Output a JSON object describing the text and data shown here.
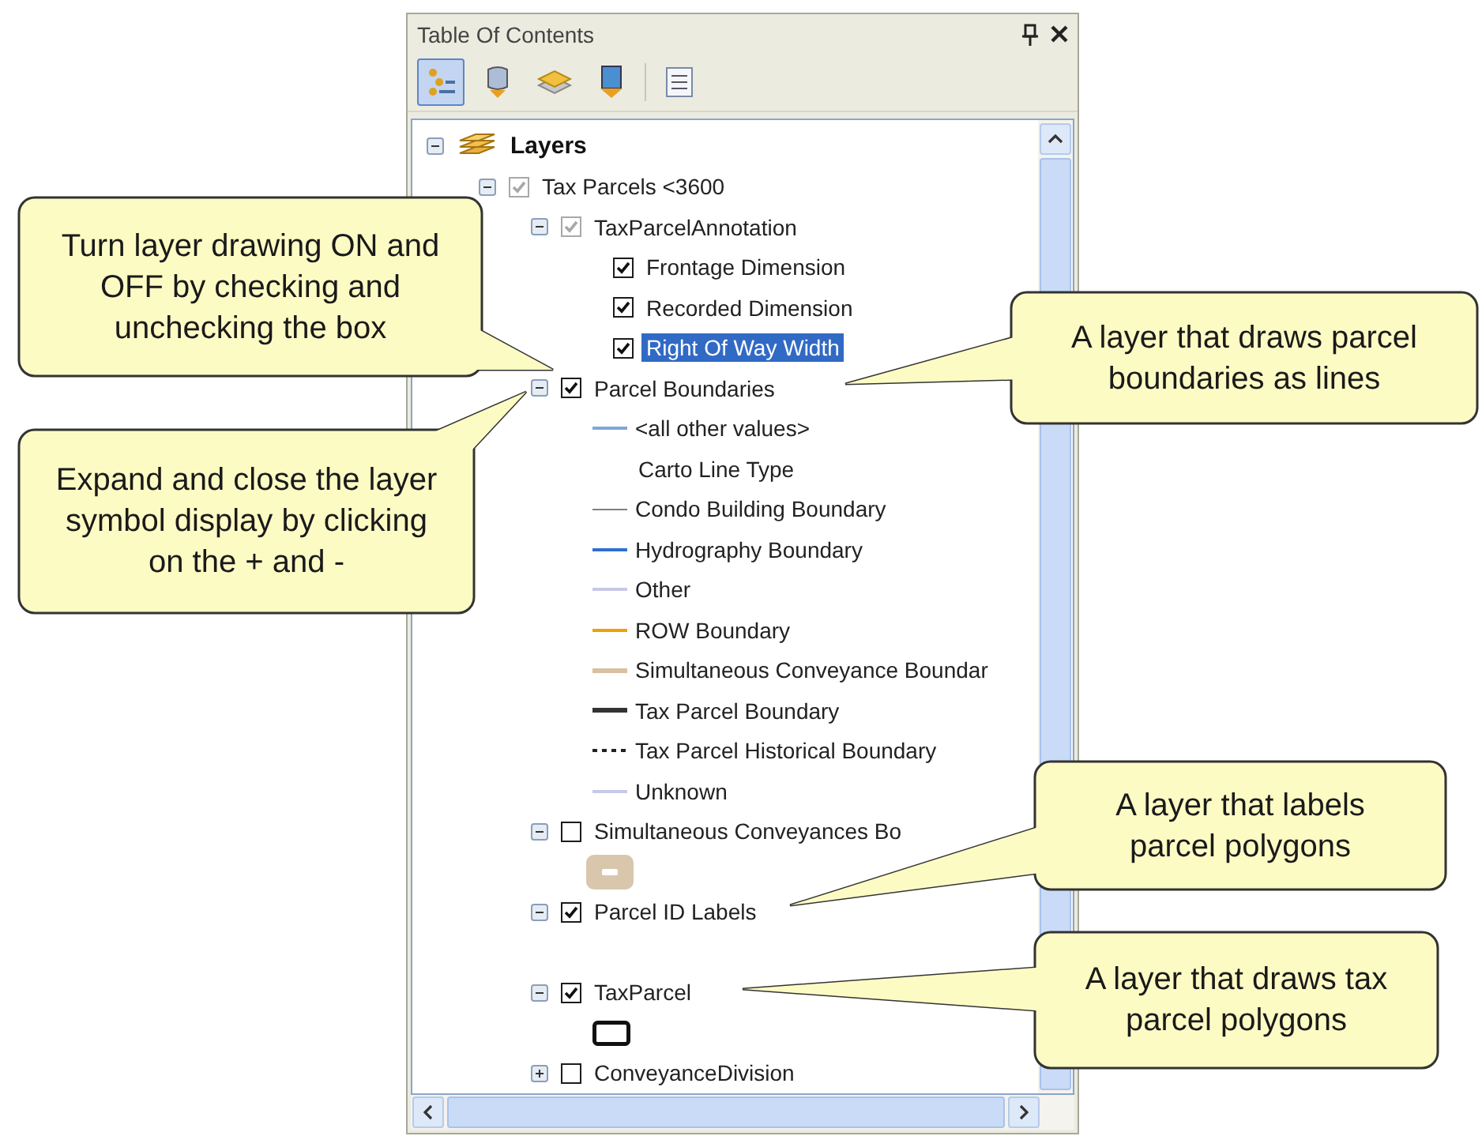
{
  "panel": {
    "title": "Table Of Contents"
  },
  "toolbar": [
    {
      "kind": "drawing-order",
      "selected": true
    },
    {
      "kind": "source",
      "selected": false
    },
    {
      "kind": "visibility",
      "selected": false
    },
    {
      "kind": "selection",
      "selected": false
    },
    {
      "kind": "options",
      "selected": false
    }
  ],
  "tree": {
    "label": "Layers",
    "kind": "frame",
    "expanded": true,
    "children": [
      {
        "label": "Tax Parcels <3600",
        "kind": "layer",
        "checked": true,
        "dimmed": true,
        "expanded": true,
        "selected": false,
        "children": [
          {
            "label": "TaxParcelAnnotation",
            "kind": "layer",
            "checked": true,
            "dimmed": true,
            "expanded": true,
            "selected": false,
            "children": [
              {
                "label": "Frontage Dimension",
                "kind": "class",
                "checked": true,
                "dimmed": false,
                "selected": false
              },
              {
                "label": "Recorded Dimension",
                "kind": "class",
                "checked": true,
                "dimmed": false,
                "selected": false
              },
              {
                "label": "Right Of Way Width",
                "kind": "class",
                "checked": true,
                "dimmed": false,
                "selected": true
              }
            ]
          },
          {
            "label": "Parcel Boundaries",
            "kind": "layer",
            "checked": true,
            "dimmed": false,
            "expanded": true,
            "selected": false,
            "children": [
              {
                "label": "<all other values>",
                "kind": "line",
                "color": "#7fa6dc"
              },
              {
                "label": "Carto Line Type",
                "kind": "heading"
              },
              {
                "label": "Condo Building Boundary",
                "kind": "thin-line",
                "color": "#808080"
              },
              {
                "label": "Hydrography Boundary",
                "kind": "line",
                "color": "#2e6fd0"
              },
              {
                "label": "Other",
                "kind": "line",
                "color": "#c8c8e8"
              },
              {
                "label": "ROW Boundary",
                "kind": "line",
                "color": "#f0a000"
              },
              {
                "label": "Simultaneous Conveyance Boundar",
                "kind": "thick-line",
                "color": "#d8c0a0"
              },
              {
                "label": "Tax Parcel Boundary",
                "kind": "thick-line",
                "color": "#333333"
              },
              {
                "label": "Tax Parcel Historical Boundary",
                "kind": "dotted-line",
                "color": "#222222"
              },
              {
                "label": "Unknown",
                "kind": "line",
                "color": "#c8c8e8"
              }
            ]
          },
          {
            "label": "Simultaneous Conveyances Bo",
            "kind": "layer",
            "checked": false,
            "dimmed": false,
            "expanded": true,
            "selected": false,
            "children": [
              {
                "kind": "fill-symbol"
              }
            ]
          },
          {
            "label": "Parcel ID Labels",
            "kind": "layer",
            "checked": true,
            "dimmed": false,
            "expanded": true,
            "selected": false
          },
          {
            "label": "TaxParcel",
            "kind": "layer",
            "checked": true,
            "dimmed": false,
            "expanded": true,
            "selected": false,
            "children": [
              {
                "kind": "outline-symbol"
              }
            ]
          },
          {
            "label": "ConveyanceDivision",
            "kind": "layer",
            "checked": false,
            "dimmed": false,
            "expanded": false,
            "selected": false
          }
        ]
      }
    ]
  },
  "callouts": [
    {
      "text": "Turn layer drawing ON and OFF by checking and unchecking the box"
    },
    {
      "text": "Expand and close the layer symbol display by clicking on the + and -"
    },
    {
      "text": "A layer that draws parcel boundaries as lines"
    },
    {
      "text": "A layer that labels parcel polygons"
    },
    {
      "text": "A layer that draws tax parcel polygons"
    }
  ]
}
